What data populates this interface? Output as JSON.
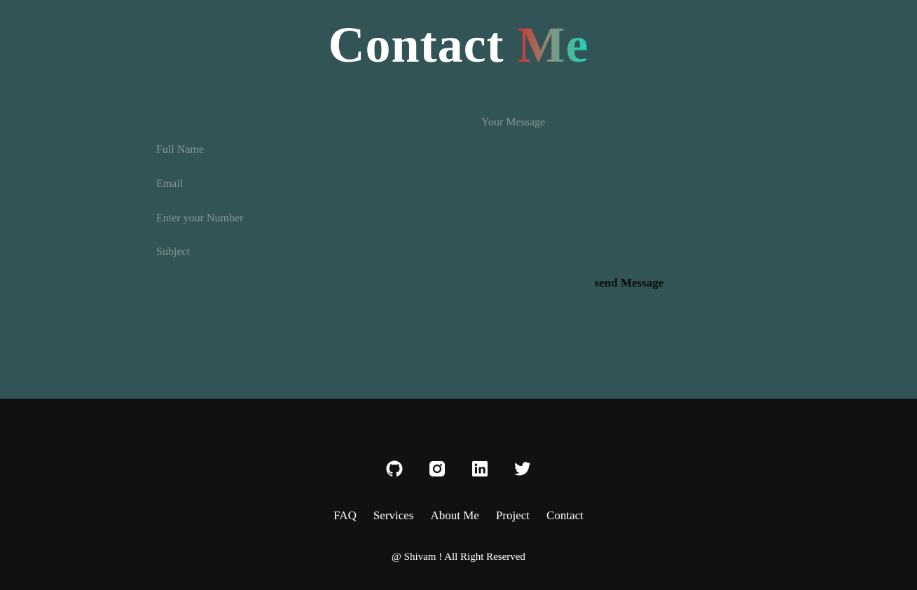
{
  "heading": {
    "main": "Contact",
    "accent": "Me"
  },
  "form": {
    "full_name_placeholder": "Full Name",
    "email_placeholder": "Email",
    "number_placeholder": "Enter your Number",
    "subject_placeholder": "Subject",
    "message_placeholder": "Your Message",
    "full_name_value": "",
    "email_value": "",
    "number_value": "",
    "subject_value": "",
    "message_value": "",
    "send_label": "send Message"
  },
  "footer": {
    "socials": [
      "github-icon",
      "instagram-icon",
      "linkedin-icon",
      "twitter-icon"
    ],
    "links": [
      "FAQ",
      "Services",
      "About Me",
      "Project",
      "Contact"
    ],
    "copyright": "@ Shivam ! All Right Reserved"
  },
  "colors": {
    "section_bg": "#325456",
    "footer_bg": "#111111",
    "accent_gradient_start": "#d0312d",
    "accent_gradient_end": "#16d6b9"
  }
}
